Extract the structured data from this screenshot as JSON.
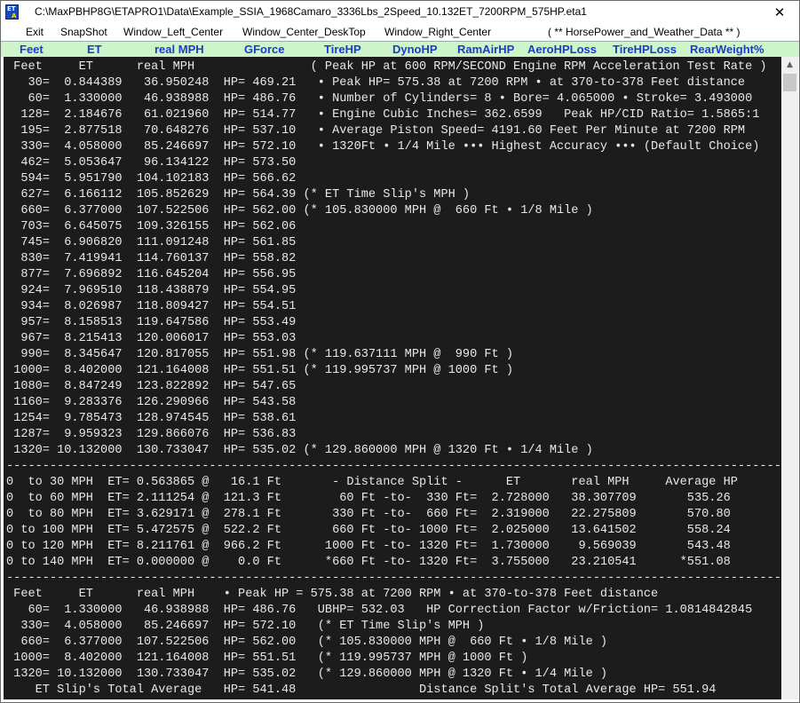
{
  "window": {
    "title": "C:\\MaxPBHP8G\\ETAPRO1\\Data\\Example_SSIA_1968Camaro_3336Lbs_2Speed_10.132ET_7200RPM_575HP.eta1",
    "icon_text_top": "ET",
    "icon_text_bottom": "A",
    "close_glyph": "✕"
  },
  "menu": {
    "items": [
      "Exit",
      "SnapShot",
      "Window_Left_Center",
      "Window_Center_DeskTop",
      "Window_Right_Center",
      "( ** HorsePower_and_Weather_Data ** )"
    ]
  },
  "columns": [
    "Feet",
    "ET",
    "real MPH",
    "GForce",
    "TireHP",
    "DynoHP",
    "RamAirHP",
    "AeroHPLoss",
    "TireHPLoss",
    "RearWeight%"
  ],
  "output_lines": [
    " Feet     ET      real MPH                ( Peak HP at 600 RPM/SECOND Engine RPM Acceleration Test Rate )",
    "   30=  0.844389   36.950248  HP= 469.21   • Peak HP= 575.38 at 7200 RPM • at 370-to-378 Feet distance",
    "   60=  1.330000   46.938988  HP= 486.76   • Number of Cylinders= 8 • Bore= 4.065000 • Stroke= 3.493000",
    "  128=  2.184676   61.021960  HP= 514.77   • Engine Cubic Inches= 362.6599   Peak HP/CID Ratio= 1.5865:1",
    "  195=  2.877518   70.648276  HP= 537.10   • Average Piston Speed= 4191.60 Feet Per Minute at 7200 RPM",
    "  330=  4.058000   85.246697  HP= 572.10   • 1320Ft • 1/4 Mile ••• Highest Accuracy ••• (Default Choice)",
    "  462=  5.053647   96.134122  HP= 573.50",
    "  594=  5.951790  104.102183  HP= 566.62",
    "  627=  6.166112  105.852629  HP= 564.39 (* ET Time Slip's MPH )",
    "  660=  6.377000  107.522506  HP= 562.00 (* 105.830000 MPH @  660 Ft • 1/8 Mile )",
    "  703=  6.645075  109.326155  HP= 562.06",
    "  745=  6.906820  111.091248  HP= 561.85",
    "  830=  7.419941  114.760137  HP= 558.82",
    "  877=  7.696892  116.645204  HP= 556.95",
    "  924=  7.969510  118.438879  HP= 554.95",
    "  934=  8.026987  118.809427  HP= 554.51",
    "  957=  8.158513  119.647586  HP= 553.49",
    "  967=  8.215413  120.006017  HP= 553.03",
    "  990=  8.345647  120.817055  HP= 551.98 (* 119.637111 MPH @  990 Ft )",
    " 1000=  8.402000  121.164008  HP= 551.51 (* 119.995737 MPH @ 1000 Ft )",
    " 1080=  8.847249  123.822892  HP= 547.65",
    " 1160=  9.283376  126.290966  HP= 543.58",
    " 1254=  9.785473  128.974545  HP= 538.61",
    " 1287=  9.959323  129.866076  HP= 536.83",
    " 1320= 10.132000  130.733047  HP= 535.02 (* 129.860000 MPH @ 1320 Ft • 1/4 Mile )",
    "-----------------------------------------------------------------------------------------------------------",
    "0  to 30 MPH  ET= 0.563865 @   16.1 Ft       - Distance Split -      ET       real MPH     Average HP",
    "0  to 60 MPH  ET= 2.111254 @  121.3 Ft        60 Ft -to-  330 Ft=  2.728000   38.307709       535.26",
    "0  to 80 MPH  ET= 3.629171 @  278.1 Ft       330 Ft -to-  660 Ft=  2.319000   22.275809       570.80",
    "0 to 100 MPH  ET= 5.472575 @  522.2 Ft       660 Ft -to- 1000 Ft=  2.025000   13.641502       558.24",
    "0 to 120 MPH  ET= 8.211761 @  966.2 Ft      1000 Ft -to- 1320 Ft=  1.730000    9.569039       543.48",
    "0 to 140 MPH  ET= 0.000000 @    0.0 Ft      *660 Ft -to- 1320 Ft=  3.755000   23.210541      *551.08",
    "-----------------------------------------------------------------------------------------------------------",
    " Feet     ET      real MPH    • Peak HP = 575.38 at 7200 RPM • at 370-to-378 Feet distance",
    "   60=  1.330000   46.938988  HP= 486.76   UBHP= 532.03   HP Correction Factor w/Friction= 1.0814842845",
    "  330=  4.058000   85.246697  HP= 572.10   (* ET Time Slip's MPH )",
    "  660=  6.377000  107.522506  HP= 562.00   (* 105.830000 MPH @  660 Ft • 1/8 Mile )",
    " 1000=  8.402000  121.164008  HP= 551.51   (* 119.995737 MPH @ 1000 Ft )",
    " 1320= 10.132000  130.733047  HP= 535.02   (* 129.860000 MPH @ 1320 Ft • 1/4 Mile )",
    "    ET Slip's Total Average   HP= 541.48                 Distance Split's Total Average HP= 551.94"
  ],
  "scrollbar": {
    "up_glyph": "▲",
    "thumb_position": 0
  },
  "colors": {
    "output_background": "#1c1c1c",
    "output_text": "#e8e8e8",
    "header_background": "#cdf5c9",
    "header_text": "#1a3ec8"
  }
}
